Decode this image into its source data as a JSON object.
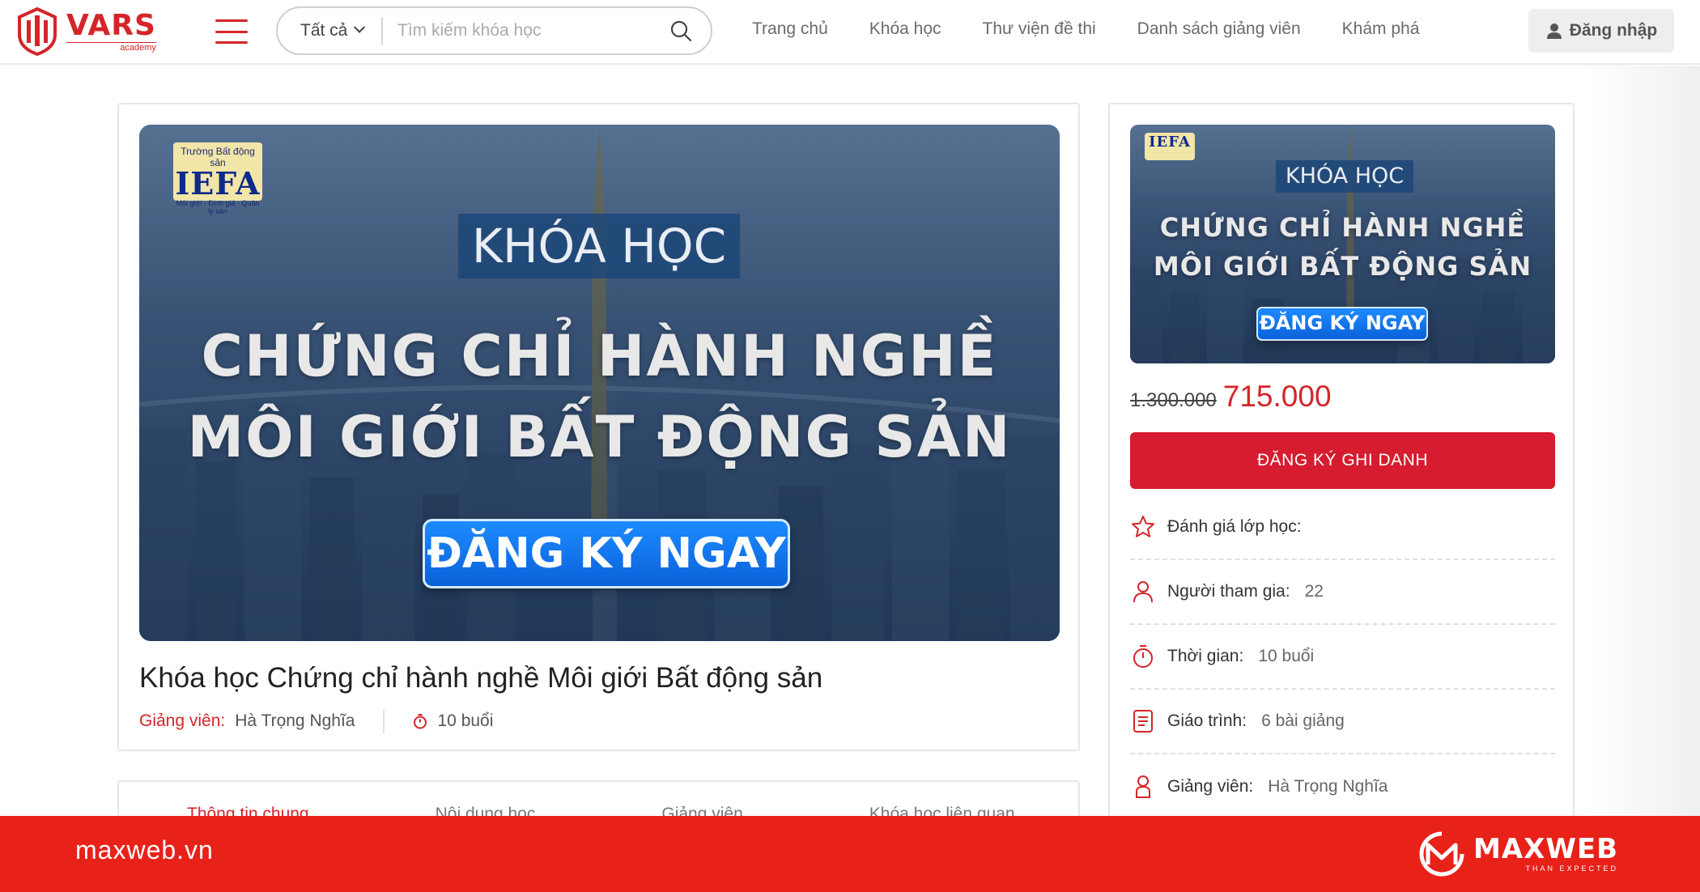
{
  "brand": {
    "name": "VARS",
    "sub": "academy"
  },
  "search": {
    "category": "Tất cả",
    "placeholder": "Tìm kiếm khóa học"
  },
  "nav": {
    "items": [
      "Trang chủ",
      "Khóa học",
      "Thư viện đề thi",
      "Danh sách giảng viên",
      "Khám phá"
    ]
  },
  "login_label": "Đăng nhập",
  "banner": {
    "school_line": "Trường Bất động sản",
    "school_logo": "IEFA",
    "school_tagline": "Môi giới - Định giá - Quản lý sàn",
    "kicker": "KHÓA HỌC",
    "headline_line1": "CHỨNG CHỈ HÀNH NGHỀ",
    "headline_line2": "MÔI GIỚI BẤT ĐỘNG SẢN",
    "cta": "ĐĂNG KÝ NGAY"
  },
  "course": {
    "title": "Khóa học Chứng chỉ hành nghề Môi giới Bất động sản",
    "lecturer_label": "Giảng viên:",
    "lecturer": "Hà Trọng Nghĩa",
    "sessions": "10 buổi"
  },
  "tabs": [
    "Thông tin chung",
    "Nội dung học",
    "Giảng viên",
    "Khóa học liên quan"
  ],
  "sidebar": {
    "old_price": "1.300.000",
    "new_price": "715.000",
    "enroll_label": "ĐĂNG KÝ GHI DANH",
    "rows": [
      {
        "key": "Đánh giá lớp học:",
        "value": "",
        "icon": "star-icon"
      },
      {
        "key": "Người tham gia:",
        "value": "22",
        "icon": "user-icon"
      },
      {
        "key": "Thời gian:",
        "value": "10 buổi",
        "icon": "stopwatch-icon"
      },
      {
        "key": "Giáo trình:",
        "value": "6 bài giảng",
        "icon": "document-icon"
      },
      {
        "key": "Giảng viên:",
        "value": "Hà Trọng Nghĩa",
        "icon": "lecturer-icon"
      }
    ]
  },
  "footer": {
    "site": "maxweb.vn",
    "brand": "MAXWEB",
    "brand_tagline": "THAN EXPECTED"
  },
  "colors": {
    "accent": "#d4252a",
    "enroll": "#d61c2e",
    "footer": "#e82119",
    "cta_blue": "#0b61d9"
  }
}
